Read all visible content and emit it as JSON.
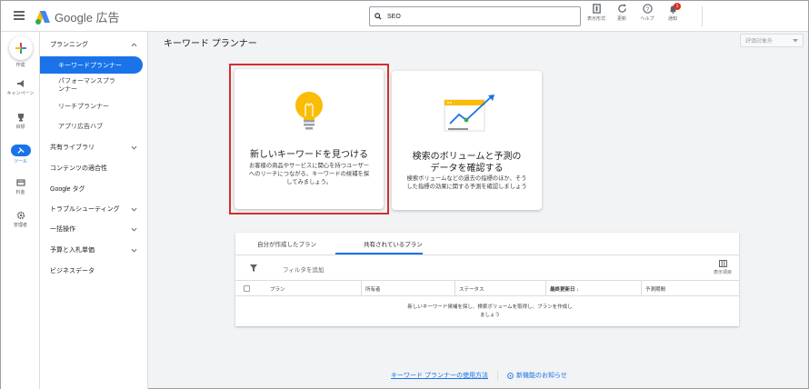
{
  "app": {
    "name": "Google 広告"
  },
  "search": {
    "value": "SEO"
  },
  "top_actions": [
    {
      "label": "表示形式",
      "icon": "chart-icon"
    },
    {
      "label": "更新",
      "icon": "refresh-icon"
    },
    {
      "label": "ヘルプ",
      "icon": "help-icon"
    },
    {
      "label": "通知",
      "icon": "bell-icon",
      "badge": "1"
    }
  ],
  "rail": {
    "create": "作成",
    "campaigns": "キャンペーン",
    "goals": "目標",
    "tools": "ツール",
    "billing": "料金",
    "admin": "管理者"
  },
  "sidebar": {
    "planning": "プランニング",
    "keyword_planner": "キーワードプランナー",
    "performance_planner": "パフォーマンスプランナー",
    "reach_planner": "リーチプランナー",
    "app_ad_hub": "アプリ広告ハブ",
    "shared_library": "共有ライブラリ",
    "content_suitability": "コンテンツの適合性",
    "google_tag": "Google タグ",
    "troubleshooting": "トラブルシューティング",
    "bulk_actions": "一括操作",
    "budgets_bidding": "予算と入札単価",
    "business_data": "ビジネスデータ"
  },
  "page": {
    "title": "キーワード プランナー",
    "filter_dropdown": "評価対象外"
  },
  "cards": {
    "discover": {
      "title": "新しいキーワードを見つける",
      "desc_line1": "お客様の商品やサービスに関心を持つユーザー",
      "desc_line2": "へのリーチにつながる、キーワードの候補を探",
      "desc_line3": "してみましょう。"
    },
    "forecast": {
      "title_line1": "検索のボリュームと予測の",
      "title_line2": "データを確認する",
      "desc_line1": "検索ボリュームなどの過去の指標のほか、そう",
      "desc_line2": "した指標の効果に関する予測を確認しましょう"
    }
  },
  "plans": {
    "tabs": [
      "自分が作成したプラン",
      "共有されているプラン"
    ],
    "active_tab": 1,
    "add_filter": "フィルタを追加",
    "columns_button": "表示項目",
    "columns": [
      "プラン",
      "所有者",
      "ステータス",
      "最終更新日",
      "予測期間"
    ],
    "sort_arrow": "↓",
    "empty_line1": "新しいキーワード候補を探し、検索ボリュームを取得し、プランを作成し",
    "empty_line2": "ましょう"
  },
  "footer": {
    "how_to": "キーワード プランナーの使用方法",
    "whats_new": "新機能のお知らせ"
  },
  "colors": {
    "accent": "#1a73e8",
    "highlight_border": "#d32f2f",
    "bulb": "#fbbc04"
  }
}
